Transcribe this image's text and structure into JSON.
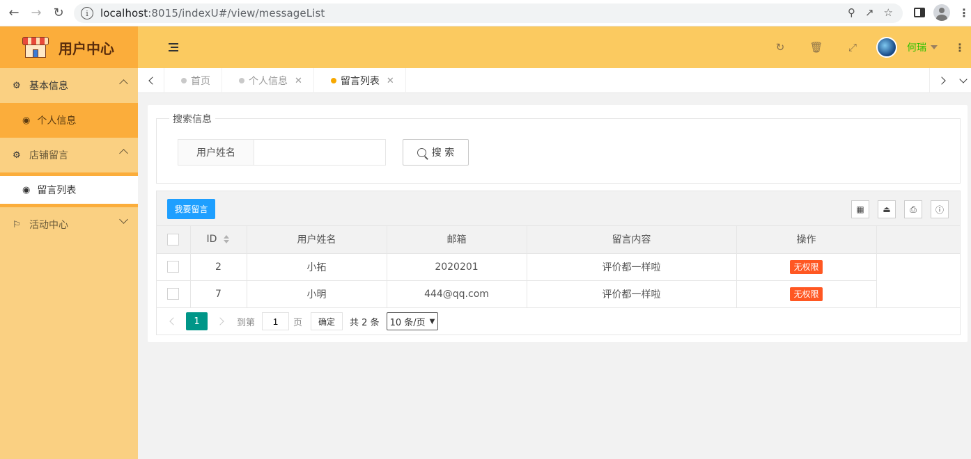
{
  "browser": {
    "url_host": "localhost",
    "url_rest": ":8015/indexU#/view/messageList"
  },
  "sidebar": {
    "logo_title": "用户中心",
    "groups": [
      {
        "label": "基本信息",
        "expanded": true,
        "items": [
          {
            "label": "个人信息"
          }
        ]
      },
      {
        "label": "店铺留言",
        "expanded": true,
        "items": [
          {
            "label": "留言列表",
            "selected": true
          }
        ]
      },
      {
        "label": "活动中心",
        "expanded": false,
        "items": []
      }
    ]
  },
  "header": {
    "user_name": "何瑞"
  },
  "tabs": [
    {
      "label": "首页",
      "active": false,
      "closable": false
    },
    {
      "label": "个人信息",
      "active": false,
      "closable": true
    },
    {
      "label": "留言列表",
      "active": true,
      "closable": true
    }
  ],
  "search": {
    "legend": "搜索信息",
    "field_label": "用户姓名",
    "input_value": "",
    "button_label": "搜 索"
  },
  "toolbar": {
    "add_label": "我要留言"
  },
  "table": {
    "columns": [
      "ID",
      "用户姓名",
      "邮箱",
      "留言内容",
      "操作"
    ],
    "rows": [
      {
        "id": "2",
        "name": "小拓",
        "email": "2020201",
        "content": "评价都一样啦",
        "action": "无权限"
      },
      {
        "id": "7",
        "name": "小明",
        "email": "444@qq.com",
        "content": "评价都一样啦",
        "action": "无权限"
      }
    ]
  },
  "pager": {
    "current": "1",
    "goto_prefix": "到第",
    "goto_value": "1",
    "goto_suffix": "页",
    "confirm": "确定",
    "total": "共 2 条",
    "page_size": "10 条/页"
  },
  "colors": {
    "sidebar_bg": "#fad082",
    "logo_bg": "#fbad3b",
    "header_bg": "#fbca60",
    "primary_button": "#1e9fff",
    "pager_active": "#009688",
    "badge_danger": "#ff5722",
    "username": "#2ec000"
  }
}
